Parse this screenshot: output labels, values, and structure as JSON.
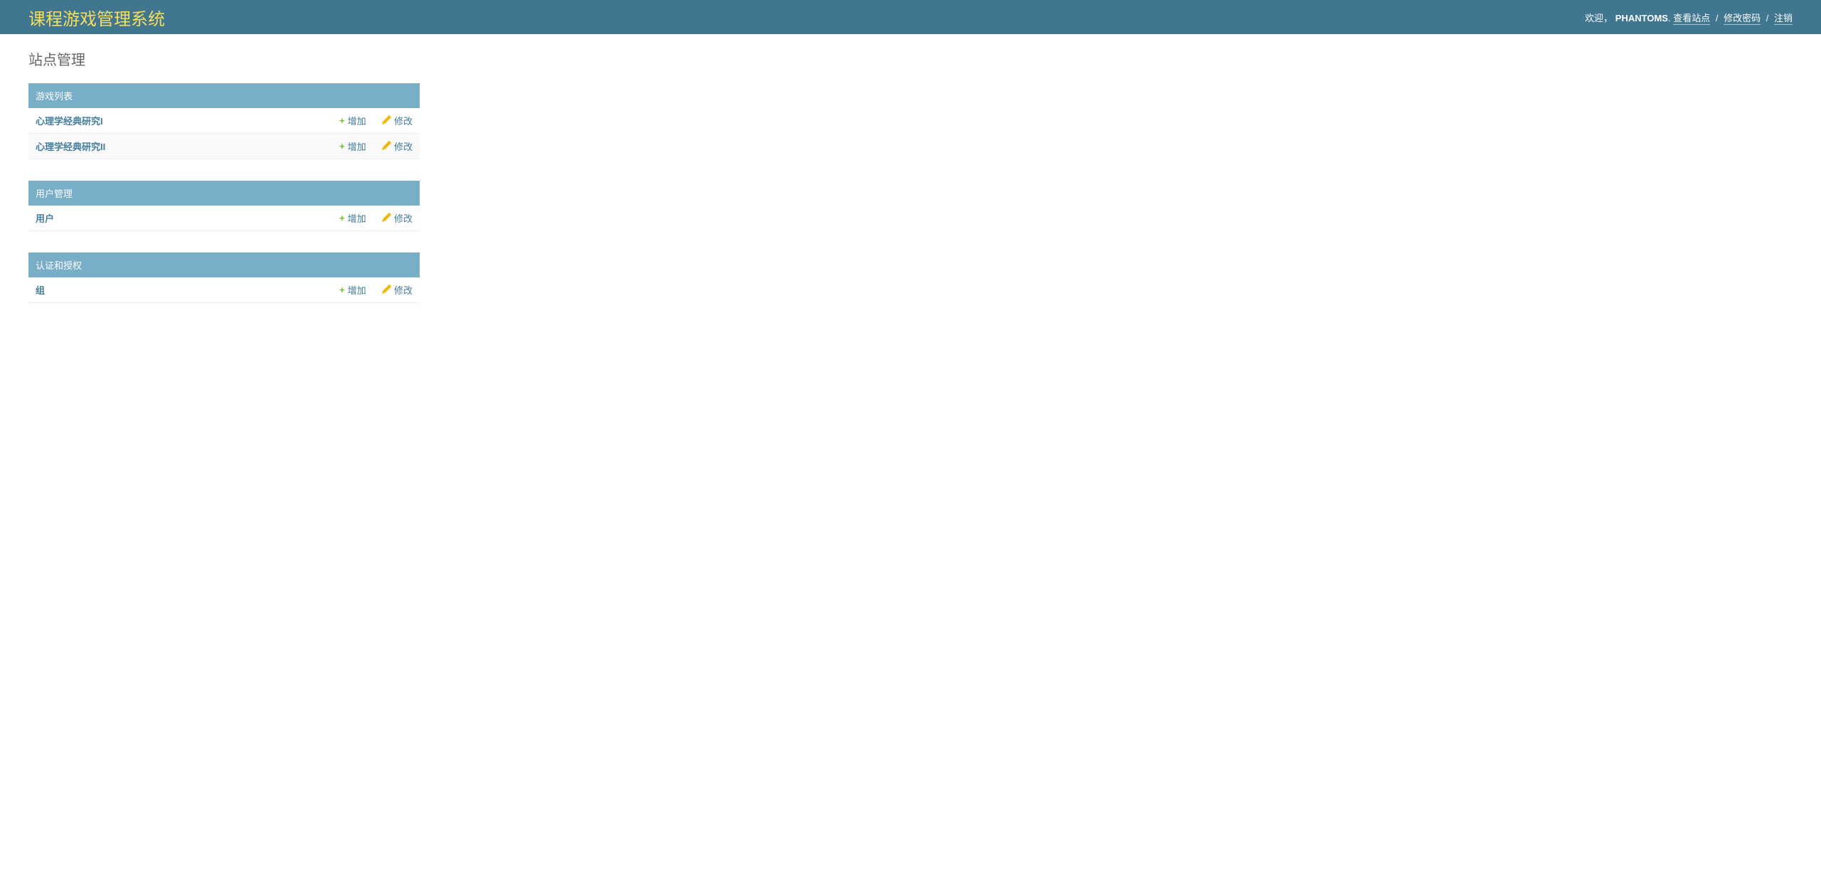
{
  "header": {
    "site_title": "课程游戏管理系统",
    "welcome": "欢迎，",
    "username": "PHANTOMS",
    "view_site": "查看站点",
    "change_password": "修改密码",
    "logout": "注销"
  },
  "page_title": "站点管理",
  "actions": {
    "add": "增加",
    "change": "修改"
  },
  "modules": [
    {
      "caption": "游戏列表",
      "rows": [
        {
          "name": "心理学经典研究I"
        },
        {
          "name": "心理学经典研究II"
        }
      ]
    },
    {
      "caption": "用户管理",
      "rows": [
        {
          "name": "用户"
        }
      ]
    },
    {
      "caption": "认证和授权",
      "rows": [
        {
          "name": "组"
        }
      ]
    }
  ]
}
